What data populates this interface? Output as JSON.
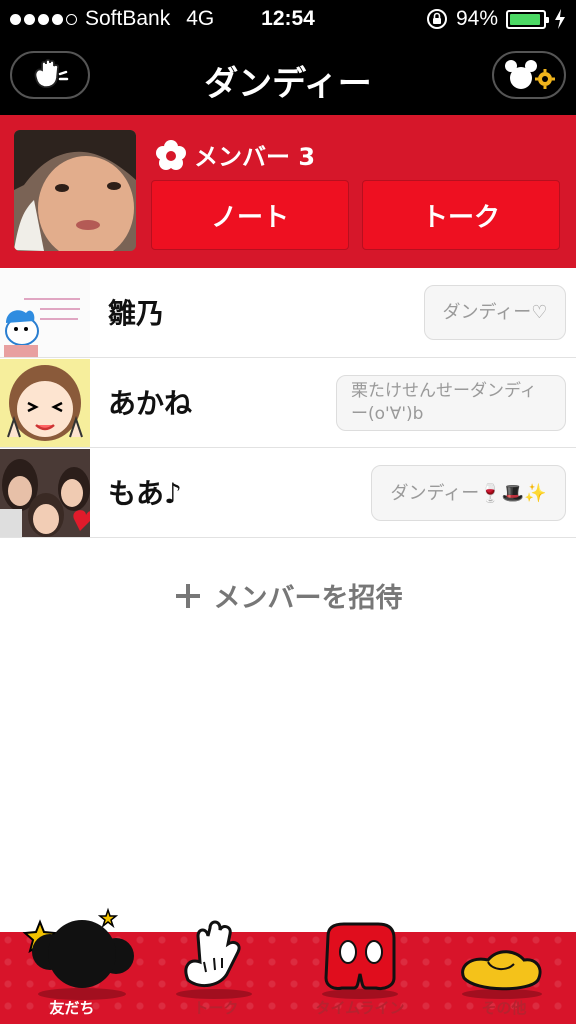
{
  "status_bar": {
    "carrier": "SoftBank",
    "network": "4G",
    "time": "12:54",
    "battery": "94%",
    "battery_level": 0.94,
    "signal_bars_filled": 4,
    "icons": [
      "signal-dots-icon",
      "orientation-lock-icon",
      "battery-icon",
      "charging-bolt-icon"
    ]
  },
  "nav": {
    "title": "ダンディー",
    "left_icon": "white-glove-hand-icon",
    "right_icon": "mickey-gear-settings-icon"
  },
  "group_header": {
    "member_label": "メンバー 3",
    "note_button": "ノート",
    "talk_button": "トーク",
    "icon": "flower-icon"
  },
  "members": [
    {
      "name": "雛乃",
      "status": "ダンディー♡"
    },
    {
      "name": "あかね",
      "status": "栗たけせんせーダンディー(o'∀')b"
    },
    {
      "name": "もあ♪",
      "status": "ダンディー🍷🎩✨"
    }
  ],
  "invite": {
    "label": "メンバーを招待",
    "icon": "plus-icon"
  },
  "tabs": [
    {
      "label": "友だち",
      "icon": "mickey-head-icon",
      "active": true
    },
    {
      "label": "トーク",
      "icon": "glove-hand-icon",
      "active": false
    },
    {
      "label": "タイムライン",
      "icon": "mickey-shorts-icon",
      "active": false
    },
    {
      "label": "その他",
      "icon": "yellow-shoe-icon",
      "active": false
    }
  ],
  "colors": {
    "header_red": "#d6172a",
    "button_red": "#ee1021",
    "tabbar_red": "#d8142a",
    "battery_green": "#4cd964"
  }
}
